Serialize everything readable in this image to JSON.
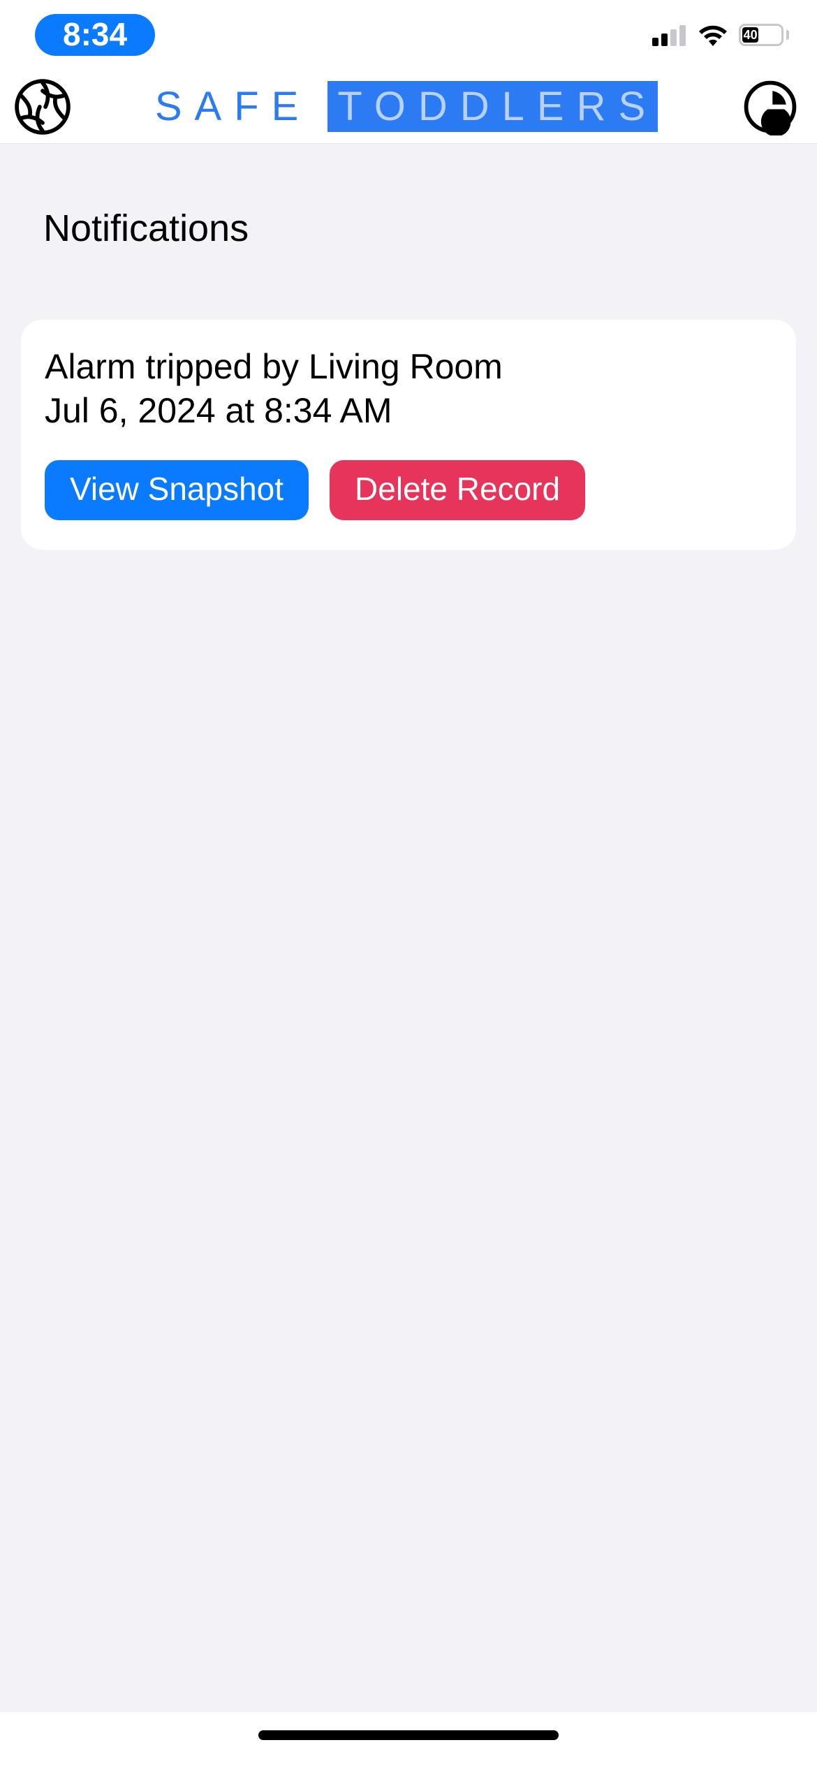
{
  "status": {
    "time": "8:34",
    "battery_percent": "40"
  },
  "header": {
    "title_part1": "SAFE",
    "title_part2": "TODDLERS"
  },
  "page": {
    "heading": "Notifications"
  },
  "notifications": [
    {
      "title": "Alarm tripped by Living Room",
      "subtitle": "Jul 6, 2024 at 8:34 AM",
      "view_label": "View Snapshot",
      "delete_label": "Delete Record"
    }
  ],
  "colors": {
    "accent": "#0a7aff",
    "danger": "#e6345b",
    "content_bg": "#f2f2f7"
  }
}
